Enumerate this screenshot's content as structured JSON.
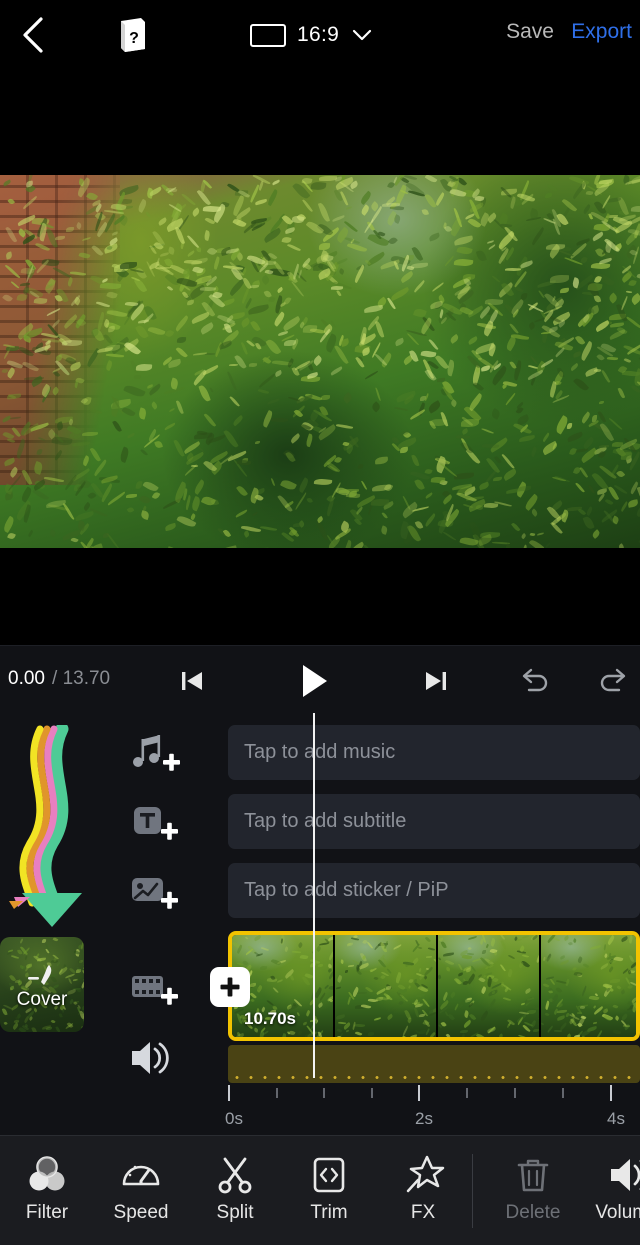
{
  "topbar": {
    "back_icon": "chevron-left-icon",
    "help_icon": "help-book-icon",
    "ratio_icon": "aspect-rectangle-icon",
    "ratio_label": "16:9",
    "chevron_icon": "chevron-down-icon",
    "save_label": "Save",
    "export_label": "Export",
    "export_color": "#2f6fe8"
  },
  "transport": {
    "current_time": "0.00",
    "separator": "/",
    "total_time": "13.70",
    "prev_icon": "skip-previous-icon",
    "play_icon": "play-icon",
    "next_icon": "skip-next-icon",
    "undo_icon": "undo-icon",
    "redo_icon": "redo-icon"
  },
  "timeline": {
    "side_icons": [
      {
        "name": "add-music-icon",
        "label": "music"
      },
      {
        "name": "add-text-icon",
        "label": "text"
      },
      {
        "name": "add-sticker-icon",
        "label": "sticker"
      },
      {
        "name": "add-clip-icon",
        "label": "clip"
      },
      {
        "name": "volume-icon",
        "label": "volume"
      }
    ],
    "tracks": [
      {
        "placeholder": "Tap to add music"
      },
      {
        "placeholder": "Tap to add subtitle"
      },
      {
        "placeholder": "Tap to add sticker / PiP"
      }
    ],
    "clip": {
      "duration": "10.70s",
      "selected_color": "#f2c300",
      "frame_count": 4,
      "add_button_icon": "plus-icon"
    },
    "ruler": {
      "labels": [
        "0s",
        "2s",
        "4s"
      ],
      "label_positions": [
        0,
        190,
        382
      ],
      "major_tick_positions": [
        0,
        190,
        382
      ],
      "minor_tick_positions": [
        48,
        95,
        143,
        238,
        286,
        334
      ]
    },
    "playhead_color": "#f2f2f2"
  },
  "cover": {
    "label": "Cover",
    "pen_icon": "pencil-edit-icon",
    "arrow_icon": "wavy-arrow-annotation",
    "arrow_colors": [
      "#4ecb96",
      "#e87fc0",
      "#e0952b",
      "#f2e424"
    ]
  },
  "toolbar": {
    "items": [
      {
        "label": "Filter",
        "icon": "filter-circles-icon",
        "disabled": false
      },
      {
        "label": "Speed",
        "icon": "speedometer-icon",
        "disabled": false
      },
      {
        "label": "Split",
        "icon": "scissors-icon",
        "disabled": false
      },
      {
        "label": "Trim",
        "icon": "trim-brackets-icon",
        "disabled": false
      },
      {
        "label": "FX",
        "icon": "magic-star-icon",
        "disabled": false
      },
      {
        "label": "Delete",
        "icon": "trash-icon",
        "disabled": true
      },
      {
        "label": "Volume",
        "icon": "volume-icon",
        "disabled": false
      }
    ]
  }
}
